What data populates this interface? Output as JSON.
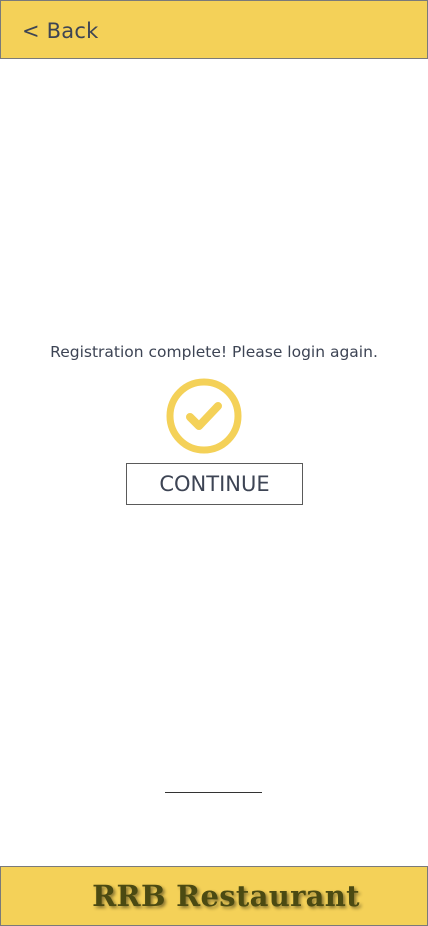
{
  "header": {
    "back_label": "< Back"
  },
  "main": {
    "message": "Registration complete! Please login again.",
    "status_icon": "check-circle-icon",
    "continue_label": "CONTINUE"
  },
  "footer": {
    "brand": "RRB Restaurant"
  },
  "colors": {
    "accent": "#f4d158",
    "text": "#3d4454",
    "brand_text": "#4b4a12"
  }
}
